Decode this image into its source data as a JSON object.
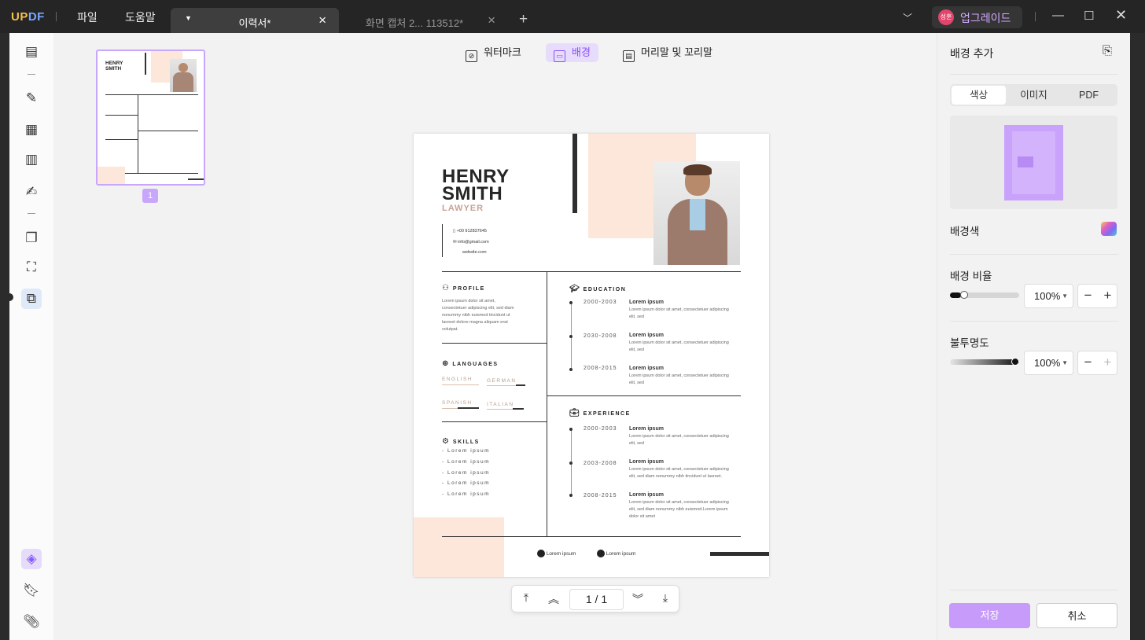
{
  "app": {
    "logo": "UPDF",
    "menu": [
      "파일",
      "도움말"
    ],
    "upgrade": "업그레이드",
    "avatar_text": "성훈"
  },
  "tabs": [
    {
      "title": "이력서*",
      "active": true
    },
    {
      "title": "화면 캡처 2... 113512*",
      "active": false
    }
  ],
  "toolbar": {
    "watermark": "워터마크",
    "background": "배경",
    "header_footer": "머리말 및 꼬리말"
  },
  "thumbnail": {
    "page_number": "1"
  },
  "resume": {
    "first_name": "HENRY",
    "last_name": "SMITH",
    "role": "LAWYER",
    "phone": "+00 912837645",
    "email": "info@gmail.com",
    "website": "website.com",
    "profile_title": "PROFILE",
    "profile_text": "Lorem ipsum dolor sit amet, consectetuer adipiscing elit, sed diam nonummy nibh euismod tincidunt ut laoreet dolore magna aliquam erat volutpat.",
    "languages_title": "LANGUAGES",
    "languages": [
      "ENGLISH",
      "GERMAN",
      "SPANISH",
      "ITALIAN"
    ],
    "skills_title": "SKILLS",
    "skills": [
      "- Lorem ipsum",
      "- Lorem ipsum",
      "- Lorem ipsum",
      "- Lorem ipsum",
      "- Lorem ipsum"
    ],
    "education_title": "EDUCATION",
    "education": [
      {
        "years": "2000-2003",
        "title": "Lorem ipsum",
        "text": "Lorem ipsum dolor sit amet, consectetuer adipiscing elit, sed"
      },
      {
        "years": "2030-2008",
        "title": "Lorem ipsum",
        "text": "Lorem ipsum dolor sit amet, consectetuer adipiscing elit, sed"
      },
      {
        "years": "2008-2015",
        "title": "Lorem ipsum",
        "text": "Lorem ipsum dolor sit amet, consectetuer adipiscing elit, sed"
      }
    ],
    "experience_title": "EXPERIENCE",
    "experience": [
      {
        "years": "2000-2003",
        "title": "Lorem ipsum",
        "text": "Lorem ipsum dolor sit amet, consectetuer adipiscing elit, sed"
      },
      {
        "years": "2003-2008",
        "title": "Lorem ipsum",
        "text": "Lorem ipsum dolor sit amet, consectetuer adipiscing elit, sed diam nonummy nibh tincidunt ut laoreet."
      },
      {
        "years": "2008-2015",
        "title": "Lorem ipsum",
        "text": "Lorem ipsum dolor sit amet, consectetuer adipiscing elit, sed diam nonummy nibh euismod.Lorem ipsum dolor sit amet"
      }
    ],
    "social": [
      "Lorem ipsum",
      "Lorem ipsum"
    ]
  },
  "pager": {
    "current": "1",
    "total": "1",
    "separator": "/"
  },
  "panel": {
    "title": "배경 추가",
    "tabs": [
      "색상",
      "이미지",
      "PDF"
    ],
    "bg_color_label": "배경색",
    "ratio_label": "배경 비율",
    "ratio_value": "100%",
    "opacity_label": "불투명도",
    "opacity_value": "100%",
    "save": "저장",
    "cancel": "취소",
    "accent": "#c79bf9"
  }
}
